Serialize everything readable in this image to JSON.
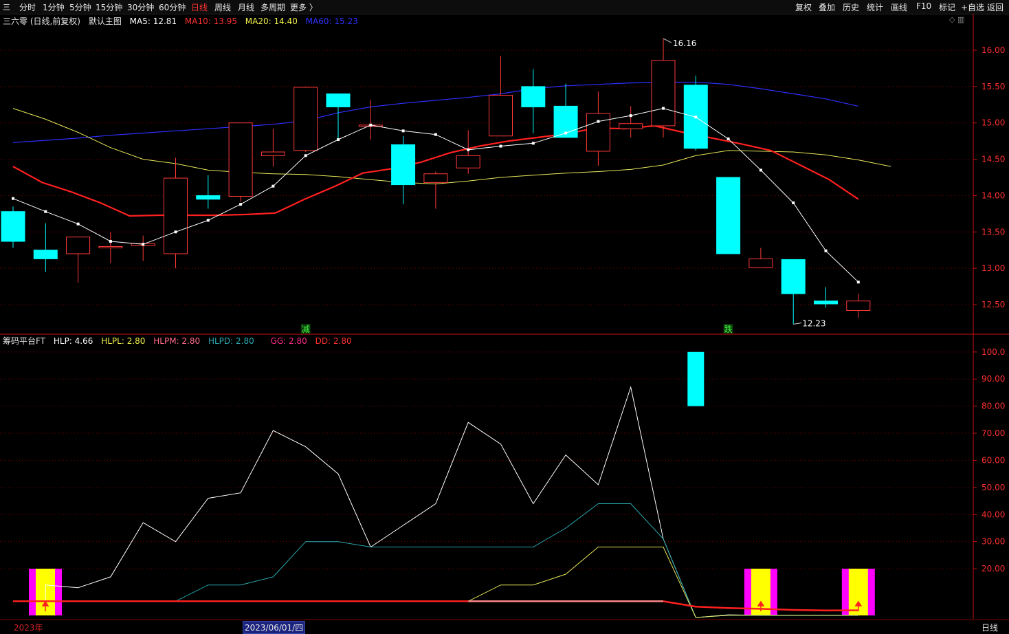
{
  "toolbar": {
    "left_icon": "三",
    "periods": [
      "分时",
      "1分钟",
      "5分钟",
      "15分钟",
      "30分钟",
      "60分钟",
      "日线",
      "周线",
      "月线",
      "多周期",
      "更多 〉"
    ],
    "active_period": "日线",
    "right": [
      "复权",
      "叠加",
      "历史",
      "统计",
      "画线",
      "F10",
      "标记",
      "+自选",
      "返回"
    ]
  },
  "main_legend": {
    "stock": "三六零 (日线,前复权)",
    "template": "默认主图",
    "ma5": "MA5: 12.81",
    "ma10": "MA10: 13.95",
    "ma20": "MA20: 14.40",
    "ma60": "MA60: 15.23"
  },
  "sub_legend": {
    "name": "筹码平台FT",
    "hlp": "HLP: 4.66",
    "hlpl": "HLPL: 2.80",
    "hlpm": "HLPM: 2.80",
    "hlpd": "HLPD: 2.80",
    "gg": "GG: 2.80",
    "dd": "DD: 2.80"
  },
  "markers": {
    "jian": "减",
    "die": "跌"
  },
  "bottom": {
    "year": "2023年",
    "cursor_date": "2023/06/01/四",
    "period": "日线"
  },
  "colors": {
    "up": "#ff3a3a",
    "down": "#00ffff",
    "ma5": "#ffffff",
    "ma10": "#ff2020",
    "ma20": "#e8e85a",
    "ma60": "#2f2fff",
    "axis": "#cc1111",
    "grid": "#7a0000"
  },
  "chart_data": [
    {
      "type": "candlestick",
      "ylim": [
        12.15,
        16.35
      ],
      "yticks": [
        "16.00",
        "15.50",
        "15.00",
        "14.50",
        "14.00",
        "13.50",
        "13.00",
        "12.50"
      ],
      "high_label": "16.16",
      "low_label": "12.23",
      "ohlc": [
        [
          13.78,
          13.85,
          13.28,
          13.37
        ],
        [
          13.25,
          13.62,
          12.95,
          13.13
        ],
        [
          13.2,
          13.42,
          12.8,
          13.43
        ],
        [
          13.28,
          13.5,
          13.07,
          13.3
        ],
        [
          13.31,
          13.45,
          13.1,
          13.34
        ],
        [
          13.2,
          14.52,
          13.0,
          14.24
        ],
        [
          14.0,
          14.28,
          13.82,
          13.95
        ],
        [
          13.99,
          15.0,
          13.92,
          15.0
        ],
        [
          14.55,
          14.92,
          14.4,
          14.6
        ],
        [
          14.62,
          15.5,
          14.6,
          15.49
        ],
        [
          15.4,
          15.4,
          14.75,
          15.22
        ],
        [
          14.97,
          15.32,
          14.77,
          14.97
        ],
        [
          14.7,
          14.82,
          13.88,
          14.15
        ],
        [
          14.18,
          14.33,
          13.82,
          14.3
        ],
        [
          14.38,
          14.9,
          14.3,
          14.55
        ],
        [
          14.82,
          15.92,
          14.82,
          15.38
        ],
        [
          15.5,
          15.74,
          14.86,
          15.22
        ],
        [
          15.23,
          15.54,
          14.8,
          14.8
        ],
        [
          14.61,
          15.43,
          14.41,
          15.13
        ],
        [
          14.92,
          15.23,
          14.8,
          14.99
        ],
        [
          14.96,
          16.16,
          14.8,
          15.86
        ],
        [
          15.52,
          15.65,
          14.62,
          14.65
        ],
        [
          14.25,
          14.25,
          13.2,
          13.2
        ],
        [
          13.01,
          13.28,
          13.01,
          13.13
        ],
        [
          13.12,
          13.12,
          12.23,
          12.65
        ],
        [
          12.55,
          12.74,
          12.46,
          12.51
        ],
        [
          12.42,
          12.65,
          12.32,
          12.55
        ]
      ],
      "ma5": [
        13.96,
        13.78,
        13.61,
        13.37,
        13.33,
        13.5,
        13.66,
        13.88,
        14.13,
        14.55,
        14.77,
        14.97,
        14.89,
        14.84,
        14.63,
        14.68,
        14.72,
        14.86,
        15.02,
        15.1,
        15.2,
        15.08,
        14.78,
        14.35,
        13.9,
        13.24,
        12.81
      ],
      "ma10": [
        14.4,
        14.18,
        14.05,
        13.9,
        13.72,
        13.73,
        13.73,
        13.73,
        13.74,
        13.76,
        13.95,
        14.12,
        14.31,
        14.37,
        14.46,
        14.59,
        14.68,
        14.75,
        14.8,
        14.85,
        14.93,
        14.92,
        14.96,
        14.87,
        14.79,
        14.71,
        14.62,
        14.42,
        14.22,
        13.95
      ],
      "ma20": [
        15.2,
        15.05,
        14.87,
        14.66,
        14.5,
        14.44,
        14.35,
        14.32,
        14.3,
        14.29,
        14.26,
        14.22,
        14.18,
        14.16,
        14.2,
        14.25,
        14.28,
        14.31,
        14.33,
        14.36,
        14.42,
        14.55,
        14.62,
        14.61,
        14.6,
        14.56,
        14.49,
        14.4
      ],
      "ma60": [
        14.73,
        14.76,
        14.79,
        14.83,
        14.86,
        14.89,
        14.92,
        14.95,
        14.98,
        15.03,
        15.14,
        15.22,
        15.27,
        15.31,
        15.35,
        15.4,
        15.47,
        15.51,
        15.53,
        15.55,
        15.56,
        15.56,
        15.53,
        15.47,
        15.4,
        15.33,
        15.23
      ]
    },
    {
      "type": "line",
      "name": "筹码平台FT",
      "ylim": [
        2,
        103
      ],
      "yticks": [
        "100.0",
        "90.00",
        "80.00",
        "70.00",
        "60.00",
        "50.00",
        "40.00",
        "30.00",
        "20.00"
      ],
      "series": [
        {
          "name": "HLP",
          "values": [
            8,
            14,
            13,
            17,
            37,
            30,
            46,
            48,
            71,
            65,
            55,
            28,
            36,
            44,
            74,
            66,
            44,
            62,
            51,
            87,
            31,
            2,
            3,
            2.8,
            2.8,
            2.8,
            2.8
          ]
        },
        {
          "name": "HLPD",
          "values": [
            8,
            8,
            8,
            8,
            8,
            8,
            14,
            14,
            17,
            30,
            30,
            28,
            28,
            28,
            28,
            28,
            28,
            35,
            44,
            44,
            31,
            2,
            2.8,
            2.8,
            2.8,
            2.8,
            2.8
          ]
        },
        {
          "name": "HLPL",
          "values": [
            8,
            8,
            8,
            8,
            8,
            8,
            8,
            8,
            8,
            8,
            8,
            8,
            8,
            8,
            8,
            14,
            14,
            18,
            28,
            28,
            28,
            2,
            2.8,
            2.8,
            2.8,
            2.8,
            2.8
          ]
        },
        {
          "name": "HLPM",
          "values": [
            8,
            8,
            8,
            8,
            8,
            8,
            8,
            8,
            8,
            8,
            8,
            8,
            8,
            8,
            8,
            8,
            8,
            8,
            8,
            8,
            8,
            6,
            5.5,
            5.2,
            4.8,
            4.6,
            4.66
          ]
        }
      ],
      "signal_bars": [
        0,
        23,
        26
      ],
      "volume_bar": {
        "index": 21,
        "low": 80,
        "high": 100
      }
    }
  ]
}
